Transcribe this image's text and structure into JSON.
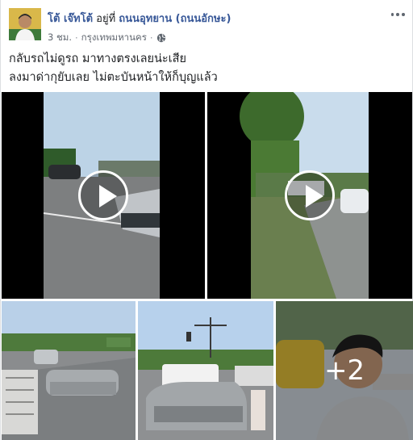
{
  "post": {
    "author": "โต้ เจ๊ทโต้",
    "action": "อยู่ที่",
    "location": "ถนนอุทยาน (ถนนอักษะ)",
    "time": "3 ชม.",
    "place": "กรุงเทพมหานคร",
    "privacy_icon": "globe-icon",
    "more_icon": "more-options-icon",
    "text_lines": [
      "กลับรถไม่ดูรถ มาทางตรงเลยน่ะเสีย",
      "ลงมาด่ากุยับเลย ไม่ตะบันหน้าให้ก็บุญแล้ว"
    ]
  },
  "media": {
    "more_count": "+2",
    "items": [
      {
        "kind": "video",
        "play_icon": "play-icon"
      },
      {
        "kind": "video",
        "play_icon": "play-icon"
      },
      {
        "kind": "photo"
      },
      {
        "kind": "photo"
      },
      {
        "kind": "photo"
      }
    ]
  },
  "colors": {
    "link": "#385898",
    "meta": "#616770",
    "video_bg": "#000000"
  }
}
